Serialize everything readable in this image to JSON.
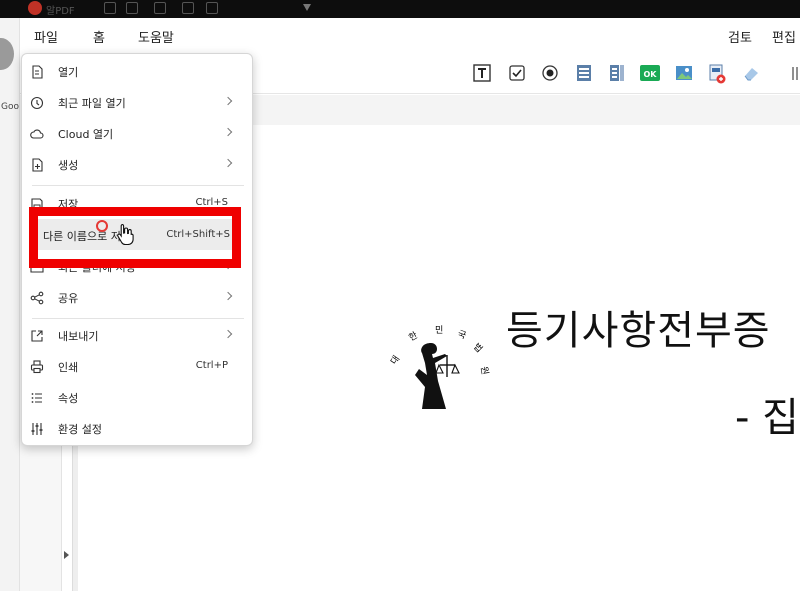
{
  "titlebar": {
    "app_name": "알PDF"
  },
  "left_strip": {
    "truncated_text": "Goo"
  },
  "menubar": {
    "tabs": [
      {
        "label": "파일"
      },
      {
        "label": "홈"
      },
      {
        "label": "도움말"
      }
    ],
    "right_tabs": [
      {
        "label": "검토"
      },
      {
        "label": "편집"
      }
    ]
  },
  "toolbar": {
    "tools": [
      "text-field-icon",
      "checkbox-icon",
      "radio-button-icon",
      "list-box-icon",
      "combo-box-icon",
      "ok-button-icon",
      "image-field-icon",
      "signature-field-icon",
      "eraser-icon",
      "more-icon"
    ],
    "ok_label": "OK"
  },
  "file_menu": {
    "items": [
      {
        "label": "열기",
        "icon": "open-file-icon",
        "shortcut": "",
        "submenu": false
      },
      {
        "label": "최근 파일 열기",
        "icon": "clock-icon",
        "shortcut": "",
        "submenu": true
      },
      {
        "label": "Cloud 열기",
        "icon": "cloud-icon",
        "shortcut": "",
        "submenu": true
      },
      {
        "label": "생성",
        "icon": "new-file-icon",
        "shortcut": "",
        "submenu": true
      },
      {
        "label": "저장",
        "icon": "save-icon",
        "shortcut": "Ctrl+S",
        "submenu": false
      },
      {
        "label": "다른 이름으로 저장",
        "icon": "",
        "shortcut": "Ctrl+Shift+S",
        "submenu": false
      },
      {
        "label": "최근 폴더에 저장",
        "icon": "folder-clock-icon",
        "shortcut": "",
        "submenu": true
      },
      {
        "label": "공유",
        "icon": "share-icon",
        "shortcut": "",
        "submenu": true
      },
      {
        "label": "내보내기",
        "icon": "export-icon",
        "shortcut": "",
        "submenu": true
      },
      {
        "label": "인쇄",
        "icon": "print-icon",
        "shortcut": "Ctrl+P",
        "submenu": false
      },
      {
        "label": "속성",
        "icon": "properties-icon",
        "shortcut": "",
        "submenu": false
      },
      {
        "label": "환경 설정",
        "icon": "settings-sliders-icon",
        "shortcut": "",
        "submenu": false
      }
    ]
  },
  "document": {
    "title": "등기사항전부증",
    "subtitle": "- 집",
    "emblem_text": [
      "대",
      "한",
      "민",
      "국",
      "법",
      "원"
    ]
  },
  "colors": {
    "highlight_box": "#ef0000",
    "titlebar": "#0d0d0d",
    "ok_button": "#1aaa55"
  }
}
